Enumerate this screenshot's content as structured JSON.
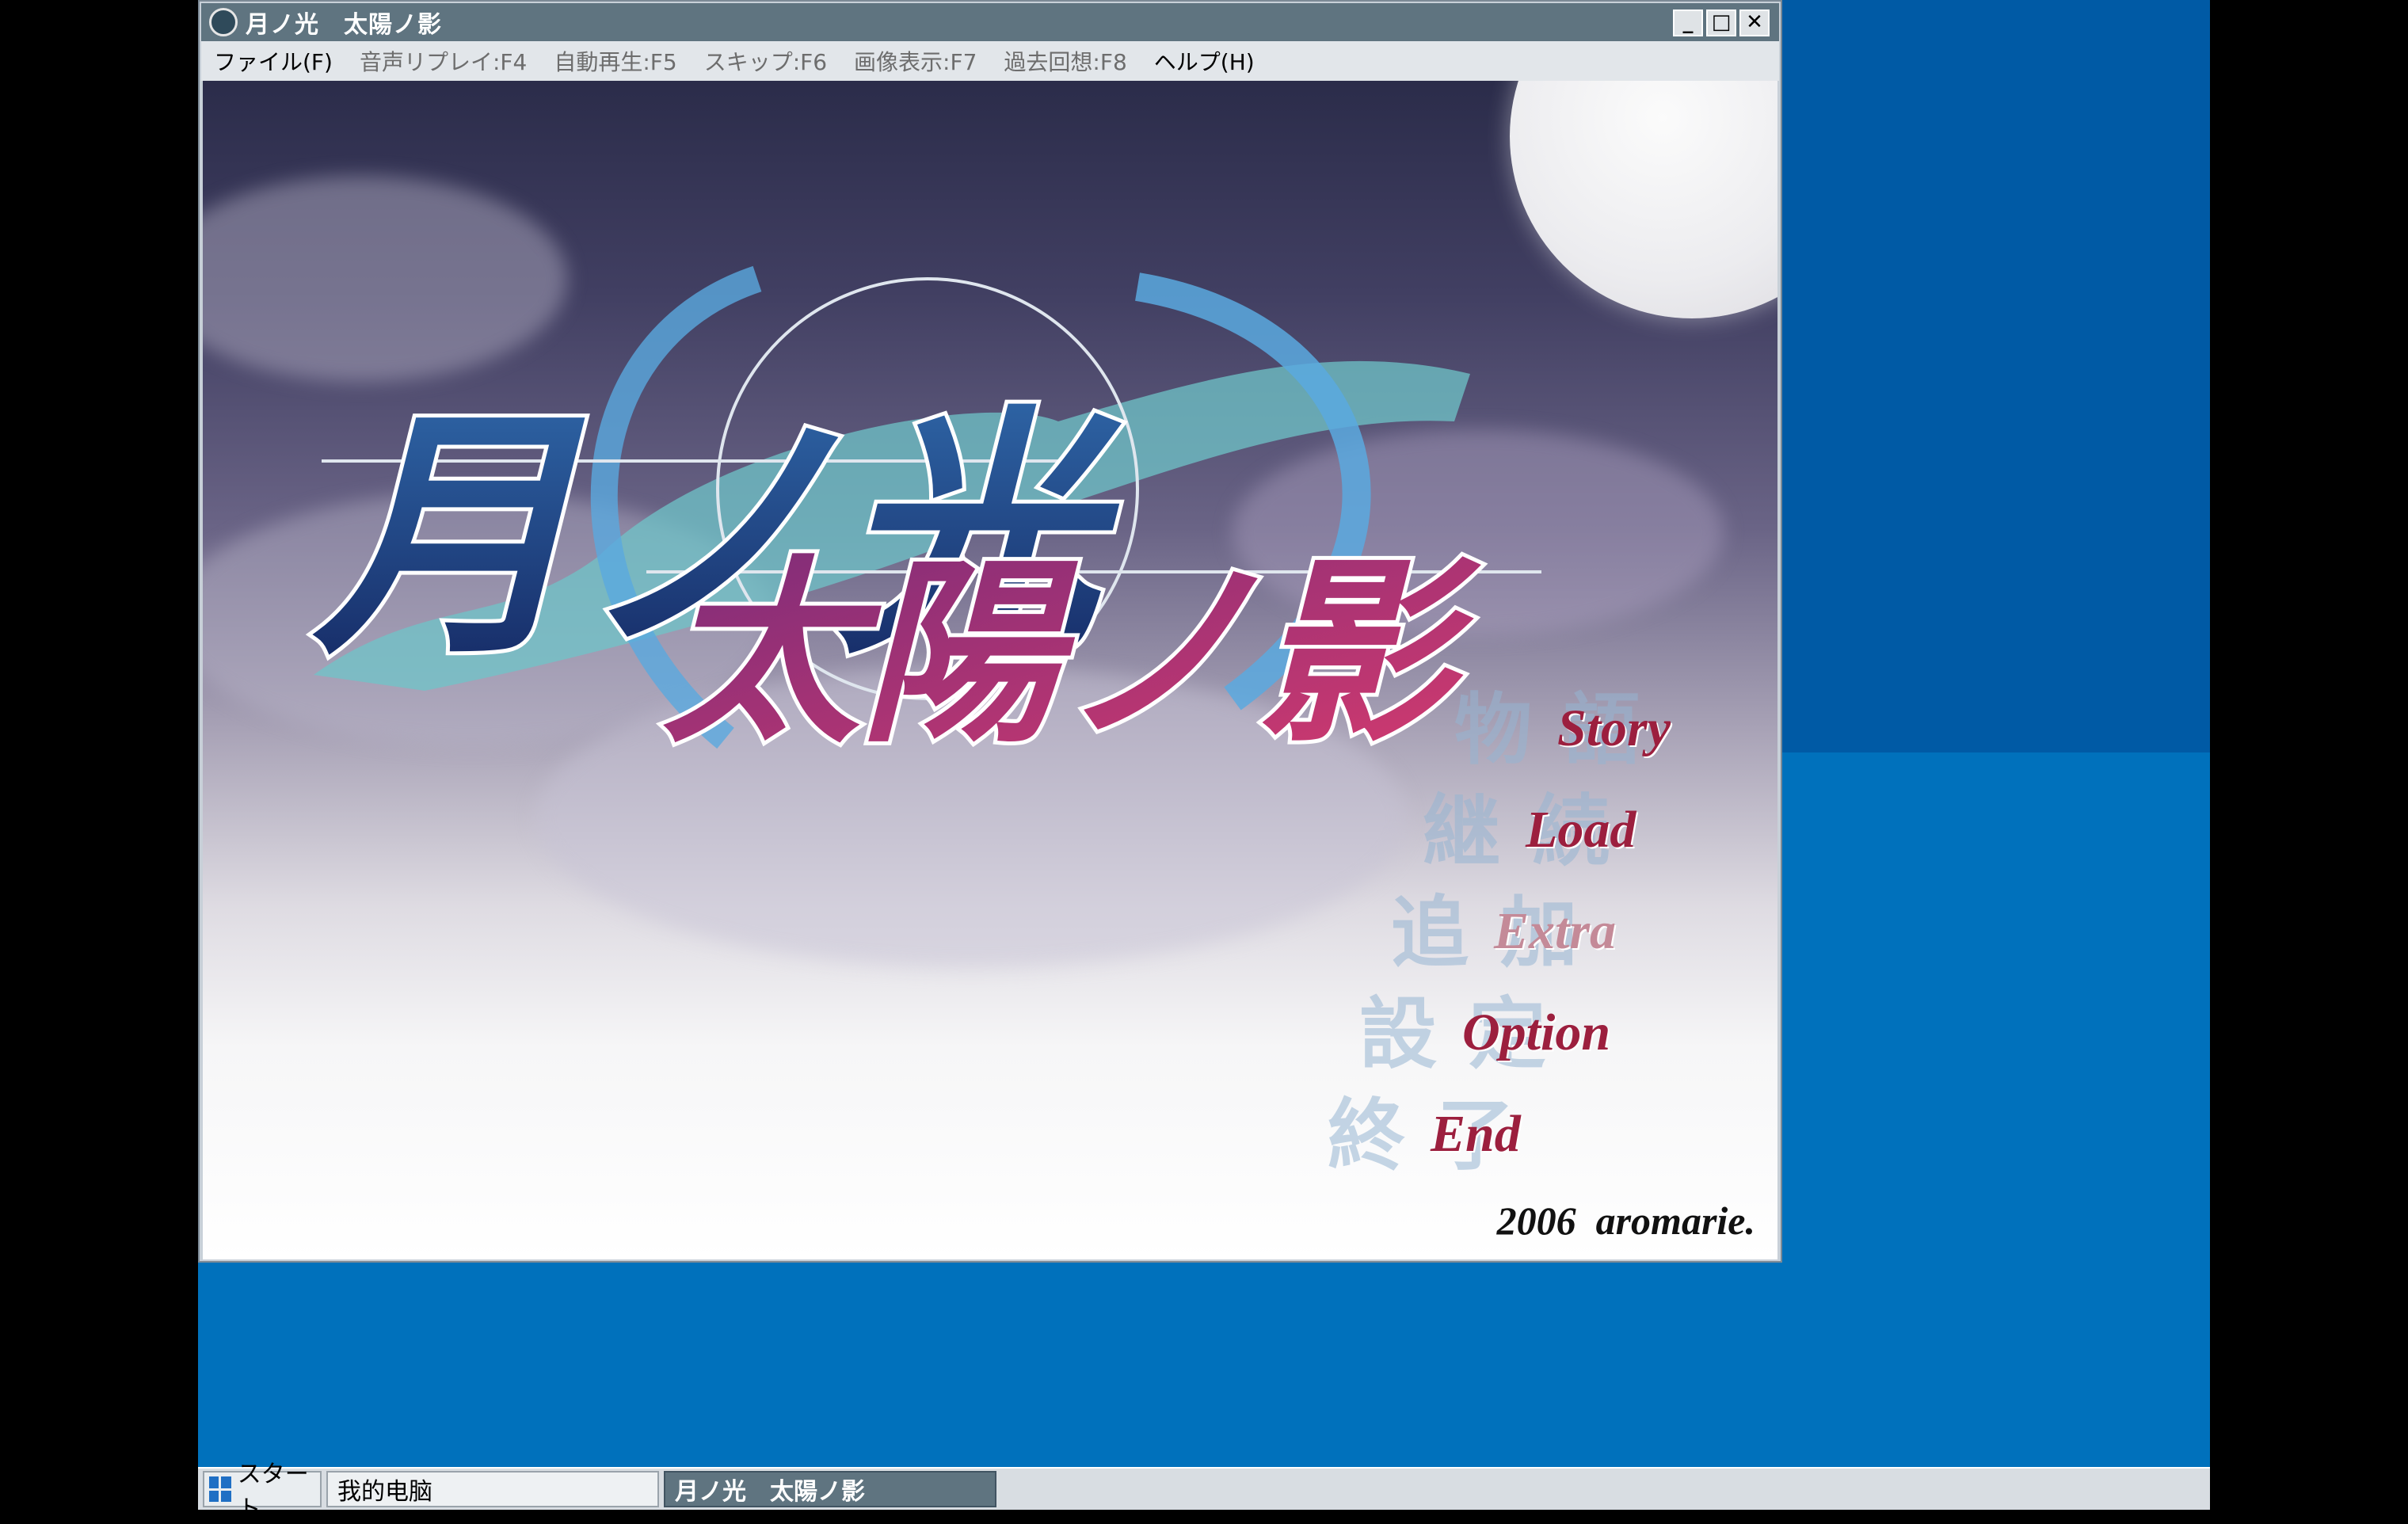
{
  "window": {
    "title": "月ノ光　太陽ノ影",
    "icon": "app-globe-icon",
    "controls": {
      "minimize": "_",
      "maximize": "□",
      "close": "✕"
    }
  },
  "menubar": {
    "items": [
      {
        "label": "ファイル(F)",
        "enabled": true
      },
      {
        "label": "音声リプレイ:F4",
        "enabled": false
      },
      {
        "label": "自動再生:F5",
        "enabled": false
      },
      {
        "label": "スキップ:F6",
        "enabled": false
      },
      {
        "label": "画像表示:F7",
        "enabled": false
      },
      {
        "label": "過去回想:F8",
        "enabled": false
      },
      {
        "label": "ヘルプ(H)",
        "enabled": true
      }
    ]
  },
  "game": {
    "logo": {
      "line1": "月ノ光",
      "line2": "太陽ノ影"
    },
    "menu": [
      {
        "kanji": "物語",
        "label": "Story"
      },
      {
        "kanji": "継続",
        "label": "Load"
      },
      {
        "kanji": "追加",
        "label": "Extra"
      },
      {
        "kanji": "設定",
        "label": "Option"
      },
      {
        "kanji": "終了",
        "label": "End"
      }
    ],
    "copyright": "2006  aromarie."
  },
  "taskbar": {
    "start_label": "スタート",
    "tasks": [
      "我的电脑",
      "月ノ光　太陽ノ影"
    ]
  },
  "colors": {
    "desktop": "#0071bc",
    "titlebar": "#5f7480",
    "menu_label": "#9c1f3e",
    "logo_blue": "#1c2f6e",
    "logo_pink": "#b8265f"
  }
}
